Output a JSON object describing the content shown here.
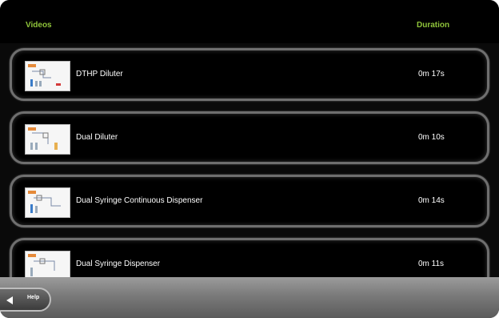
{
  "header": {
    "videos_label": "Videos",
    "duration_label": "Duration"
  },
  "videos": [
    {
      "title": "DTHP Diluter",
      "duration": "0m 17s",
      "thumbnail_icon": "diagram-thumbnail-icon"
    },
    {
      "title": "Dual Diluter",
      "duration": "0m 10s",
      "thumbnail_icon": "diagram-thumbnail-icon"
    },
    {
      "title": "Dual Syringe Continuous Dispenser",
      "duration": "0m 14s",
      "thumbnail_icon": "diagram-thumbnail-icon"
    },
    {
      "title": "Dual Syringe Dispenser",
      "duration": "0m 11s",
      "thumbnail_icon": "diagram-thumbnail-icon"
    }
  ],
  "footer": {
    "help_label": "Help",
    "back_icon": "arrow-left-icon"
  },
  "colors": {
    "header_text": "#8fc43a",
    "row_border": "#6f6f6f",
    "background": "#000000"
  }
}
